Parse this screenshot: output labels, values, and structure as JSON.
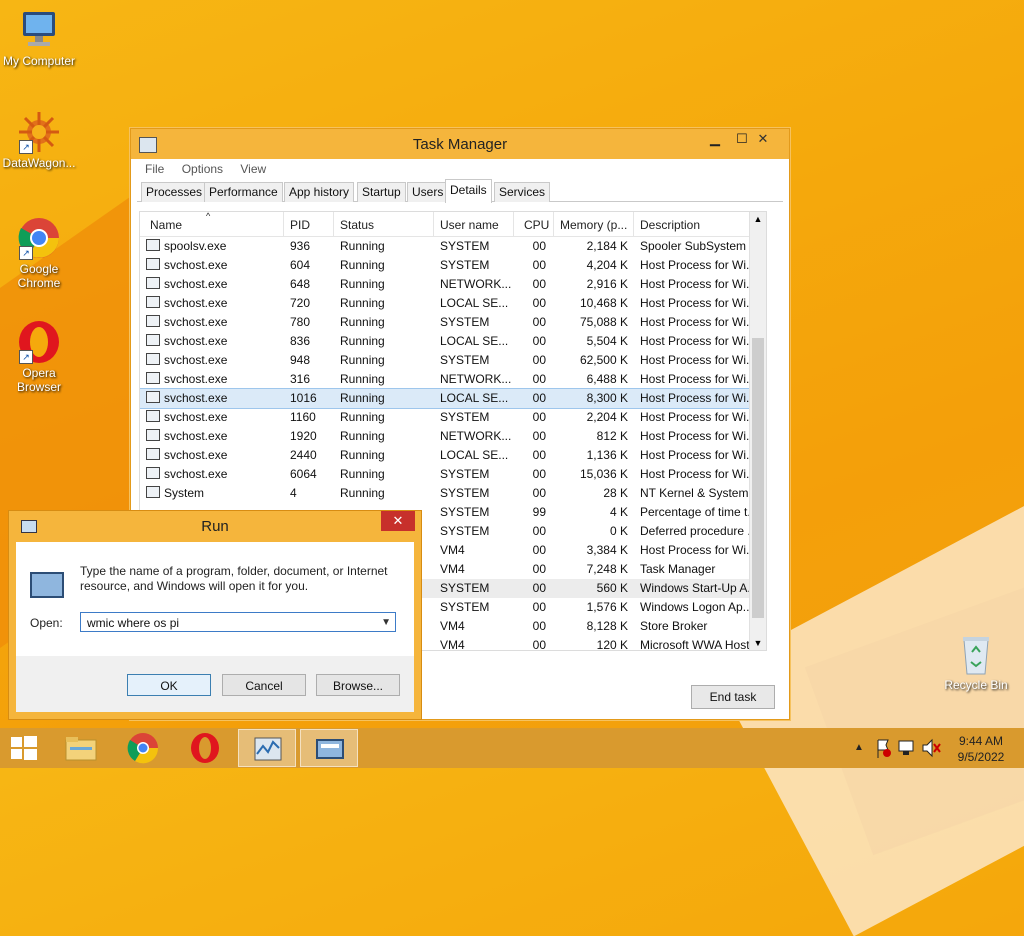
{
  "desktop": {
    "icons": [
      {
        "label": "My Computer"
      },
      {
        "label": "DataWagon..."
      },
      {
        "label": "Google Chrome"
      },
      {
        "label": "Opera Browser"
      },
      {
        "label": "Recycle Bin"
      }
    ]
  },
  "task_manager": {
    "title": "Task Manager",
    "menu": [
      "File",
      "Options",
      "View"
    ],
    "tabs": [
      "Processes",
      "Performance",
      "App history",
      "Startup",
      "Users",
      "Details",
      "Services"
    ],
    "active_tab": "Details",
    "columns": [
      "Name",
      "PID",
      "Status",
      "User name",
      "CPU",
      "Memory (p...",
      "Description"
    ],
    "rows": [
      {
        "name": "spoolsv.exe",
        "pid": "936",
        "status": "Running",
        "user": "SYSTEM",
        "cpu": "00",
        "mem": "2,184 K",
        "desc": "Spooler SubSystem ..."
      },
      {
        "name": "svchost.exe",
        "pid": "604",
        "status": "Running",
        "user": "SYSTEM",
        "cpu": "00",
        "mem": "4,204 K",
        "desc": "Host Process for Wi..."
      },
      {
        "name": "svchost.exe",
        "pid": "648",
        "status": "Running",
        "user": "NETWORK...",
        "cpu": "00",
        "mem": "2,916 K",
        "desc": "Host Process for Wi..."
      },
      {
        "name": "svchost.exe",
        "pid": "720",
        "status": "Running",
        "user": "LOCAL SE...",
        "cpu": "00",
        "mem": "10,468 K",
        "desc": "Host Process for Wi..."
      },
      {
        "name": "svchost.exe",
        "pid": "780",
        "status": "Running",
        "user": "SYSTEM",
        "cpu": "00",
        "mem": "75,088 K",
        "desc": "Host Process for Wi..."
      },
      {
        "name": "svchost.exe",
        "pid": "836",
        "status": "Running",
        "user": "LOCAL SE...",
        "cpu": "00",
        "mem": "5,504 K",
        "desc": "Host Process for Wi..."
      },
      {
        "name": "svchost.exe",
        "pid": "948",
        "status": "Running",
        "user": "SYSTEM",
        "cpu": "00",
        "mem": "62,500 K",
        "desc": "Host Process for Wi..."
      },
      {
        "name": "svchost.exe",
        "pid": "316",
        "status": "Running",
        "user": "NETWORK...",
        "cpu": "00",
        "mem": "6,488 K",
        "desc": "Host Process for Wi..."
      },
      {
        "name": "svchost.exe",
        "pid": "1016",
        "status": "Running",
        "user": "LOCAL SE...",
        "cpu": "00",
        "mem": "8,300 K",
        "desc": "Host Process for Wi..."
      },
      {
        "name": "svchost.exe",
        "pid": "1160",
        "status": "Running",
        "user": "SYSTEM",
        "cpu": "00",
        "mem": "2,204 K",
        "desc": "Host Process for Wi..."
      },
      {
        "name": "svchost.exe",
        "pid": "1920",
        "status": "Running",
        "user": "NETWORK...",
        "cpu": "00",
        "mem": "812 K",
        "desc": "Host Process for Wi..."
      },
      {
        "name": "svchost.exe",
        "pid": "2440",
        "status": "Running",
        "user": "LOCAL SE...",
        "cpu": "00",
        "mem": "1,136 K",
        "desc": "Host Process for Wi..."
      },
      {
        "name": "svchost.exe",
        "pid": "6064",
        "status": "Running",
        "user": "SYSTEM",
        "cpu": "00",
        "mem": "15,036 K",
        "desc": "Host Process for Wi..."
      },
      {
        "name": "System",
        "pid": "4",
        "status": "Running",
        "user": "SYSTEM",
        "cpu": "00",
        "mem": "28 K",
        "desc": "NT Kernel & System"
      },
      {
        "name": "",
        "pid": "",
        "status": "",
        "user": "SYSTEM",
        "cpu": "99",
        "mem": "4 K",
        "desc": "Percentage of time t..."
      },
      {
        "name": "",
        "pid": "",
        "status": "",
        "user": "SYSTEM",
        "cpu": "00",
        "mem": "0 K",
        "desc": "Deferred procedure ..."
      },
      {
        "name": "",
        "pid": "",
        "status": "",
        "user": "VM4",
        "cpu": "00",
        "mem": "3,384 K",
        "desc": "Host Process for Wi..."
      },
      {
        "name": "",
        "pid": "",
        "status": "",
        "user": "VM4",
        "cpu": "00",
        "mem": "7,248 K",
        "desc": "Task Manager"
      },
      {
        "name": "",
        "pid": "",
        "status": "",
        "user": "SYSTEM",
        "cpu": "00",
        "mem": "560 K",
        "desc": "Windows Start-Up A..."
      },
      {
        "name": "",
        "pid": "",
        "status": "",
        "user": "SYSTEM",
        "cpu": "00",
        "mem": "1,576 K",
        "desc": "Windows Logon Ap..."
      },
      {
        "name": "",
        "pid": "",
        "status": "",
        "user": "VM4",
        "cpu": "00",
        "mem": "8,128 K",
        "desc": "Store Broker"
      },
      {
        "name": "",
        "pid": "",
        "status": "",
        "user": "VM4",
        "cpu": "00",
        "mem": "120 K",
        "desc": "Microsoft WWA Host"
      }
    ],
    "end_task": "End task"
  },
  "run": {
    "title": "Run",
    "close": "✕",
    "text": "Type the name of a program, folder, document, or Internet resource, and Windows will open it for you.",
    "open_label": "Open:",
    "open_value": "wmic where os pi",
    "ok": "OK",
    "cancel": "Cancel",
    "browse": "Browse..."
  },
  "taskbar": {
    "time": "9:44 AM",
    "date": "9/5/2022"
  }
}
